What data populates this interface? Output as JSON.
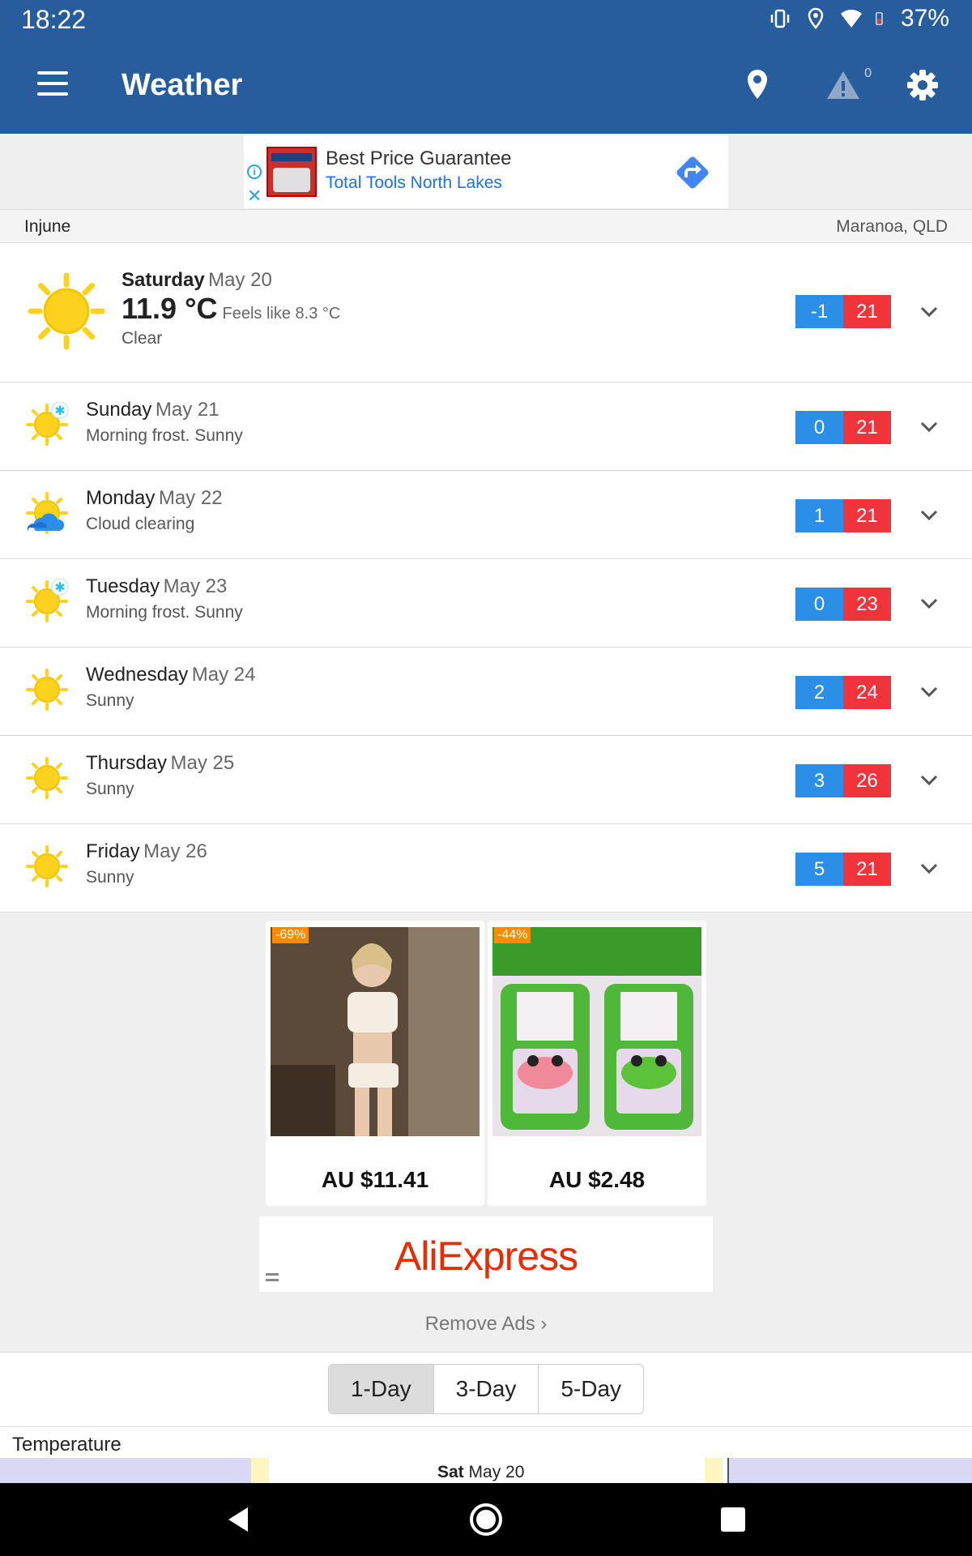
{
  "status": {
    "time": "18:22",
    "battery": "37%"
  },
  "appbar": {
    "title": "Weather",
    "alert_count": "0"
  },
  "banner_ad": {
    "headline": "Best Price Guarantee",
    "advertiser": "Total Tools North Lakes"
  },
  "location": {
    "place": "Injune",
    "region": "Maranoa, QLD"
  },
  "today": {
    "day": "Saturday",
    "date": "May 20",
    "temp": "11.9 °C",
    "feels_like": "Feels like 8.3 °C",
    "condition": "Clear",
    "low": "-1",
    "high": "21",
    "icon": "sun-icon"
  },
  "forecast": [
    {
      "day": "Sunday",
      "date": "May 21",
      "condition": "Morning frost. Sunny",
      "low": "0",
      "high": "21",
      "icon": "sun-frost-icon"
    },
    {
      "day": "Monday",
      "date": "May 22",
      "condition": "Cloud clearing",
      "low": "1",
      "high": "21",
      "icon": "sun-cloud-icon"
    },
    {
      "day": "Tuesday",
      "date": "May 23",
      "condition": "Morning frost. Sunny",
      "low": "0",
      "high": "23",
      "icon": "sun-frost-icon"
    },
    {
      "day": "Wednesday",
      "date": "May 24",
      "condition": "Sunny",
      "low": "2",
      "high": "24",
      "icon": "sun-icon"
    },
    {
      "day": "Thursday",
      "date": "May 25",
      "condition": "Sunny",
      "low": "3",
      "high": "26",
      "icon": "sun-icon"
    },
    {
      "day": "Friday",
      "date": "May 26",
      "condition": "Sunny",
      "low": "5",
      "high": "21",
      "icon": "sun-icon"
    }
  ],
  "product_ad": {
    "items": [
      {
        "discount": "-69%",
        "price": "AU $11.41"
      },
      {
        "discount": "-44%",
        "price": "AU $2.48"
      }
    ],
    "brand": "AliExpress"
  },
  "remove_ads": "Remove Ads",
  "range_tabs": [
    "1-Day",
    "3-Day",
    "5-Day"
  ],
  "selected_tab": "1-Day",
  "chart": {
    "section_label": "Temperature",
    "day_label": "Sat",
    "day_date": "May 20"
  },
  "colors": {
    "primary": "#285d9d",
    "low_temp": "#2b8fe8",
    "high_temp": "#f0343c",
    "sun": "#fcd21e"
  }
}
